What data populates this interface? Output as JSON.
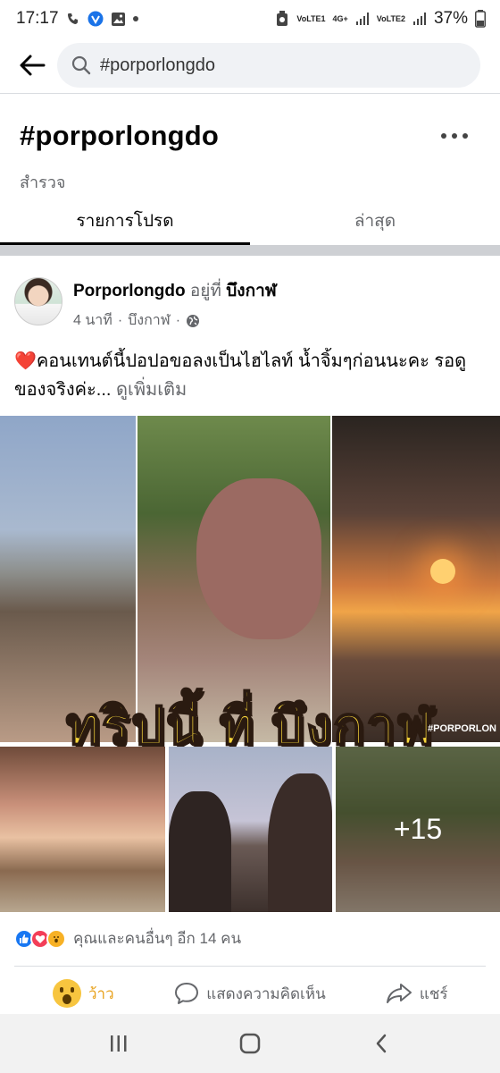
{
  "status_bar": {
    "time": "17:17",
    "sim1_label": "VoLTE1",
    "sim2_label": "VoLTE2",
    "net_label": "4G+",
    "battery": "37%",
    "icons": [
      "call-icon",
      "vpn-icon",
      "image-icon",
      "dot-icon",
      "recycle-icon",
      "signal-icon",
      "battery-icon"
    ]
  },
  "search": {
    "query": "#porporlongdo",
    "placeholder": "#porporlongdo"
  },
  "page": {
    "title": "#porporlongdo",
    "subtitle": "สำรวจ"
  },
  "tabs": [
    {
      "label": "รายการโปรด",
      "active": true
    },
    {
      "label": "ล่าสุด",
      "active": false
    }
  ],
  "post": {
    "author": "Porporlongdo",
    "at_text": "อยู่ที่",
    "place": "บึงกาฬ",
    "time": "4 นาที",
    "time_place": "บึงกาฬ",
    "text": "❤️คอนเทนต์นี้ปอปอขอลงเป็นไฮไลท์ น้ำจิ้มๆก่อนนะคะ รอดูของจริงค่ะ...",
    "see_more": "ดูเพิ่มเติม",
    "overlay_title": "ทริปนี้ ที่ บึงกาฬ",
    "watermark": "#PORPORLON",
    "more_photos": "+15",
    "reactions_text": "คุณและคนอื่นๆ อีก 14 คน",
    "reaction_types": [
      "like",
      "love",
      "wow"
    ]
  },
  "actions": {
    "react_label": "ว้าว",
    "comment_label": "แสดงความคิดเห็น",
    "share_label": "แชร์"
  },
  "colors": {
    "accent": "#1877f2",
    "wow": "#e8a11b",
    "overlay_text": "#f6d43a"
  }
}
